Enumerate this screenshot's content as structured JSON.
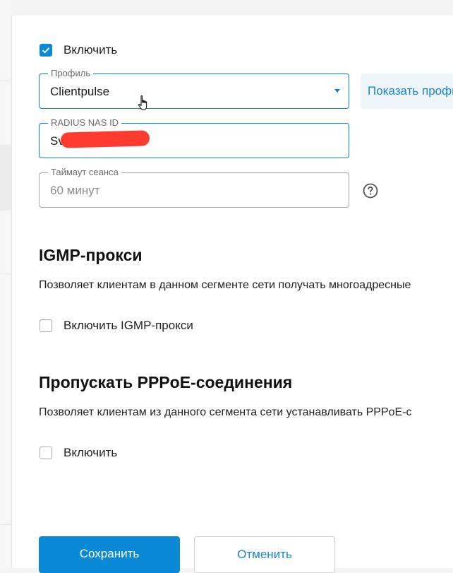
{
  "enable": {
    "label": "Включить",
    "checked": true
  },
  "profile": {
    "legend": "Профиль",
    "value": "Clientpulse"
  },
  "show_profile": {
    "label": "Показать профиль"
  },
  "radius_nas_id": {
    "legend": "RADIUS NAS ID",
    "value": "Sv"
  },
  "session_timeout": {
    "legend": "Таймаут сеанса",
    "value": "60 минут"
  },
  "igmp": {
    "title": "IGMP-прокси",
    "description": "Позволяет клиентам в данном сегменте сети получать многоадресные",
    "checkbox_label": "Включить IGMP-прокси",
    "checked": false
  },
  "pppoe": {
    "title": "Пропускать PPPoE-соединения",
    "description": "Позволяет клиентам из данного сегмента сети устанавливать PPPoE-с",
    "checkbox_label": "Включить",
    "checked": false
  },
  "actions": {
    "save": "Сохранить",
    "cancel": "Отменить"
  },
  "colors": {
    "accent": "#0a8ad6",
    "link": "#1486cc",
    "redaction": "#ff3b30"
  }
}
